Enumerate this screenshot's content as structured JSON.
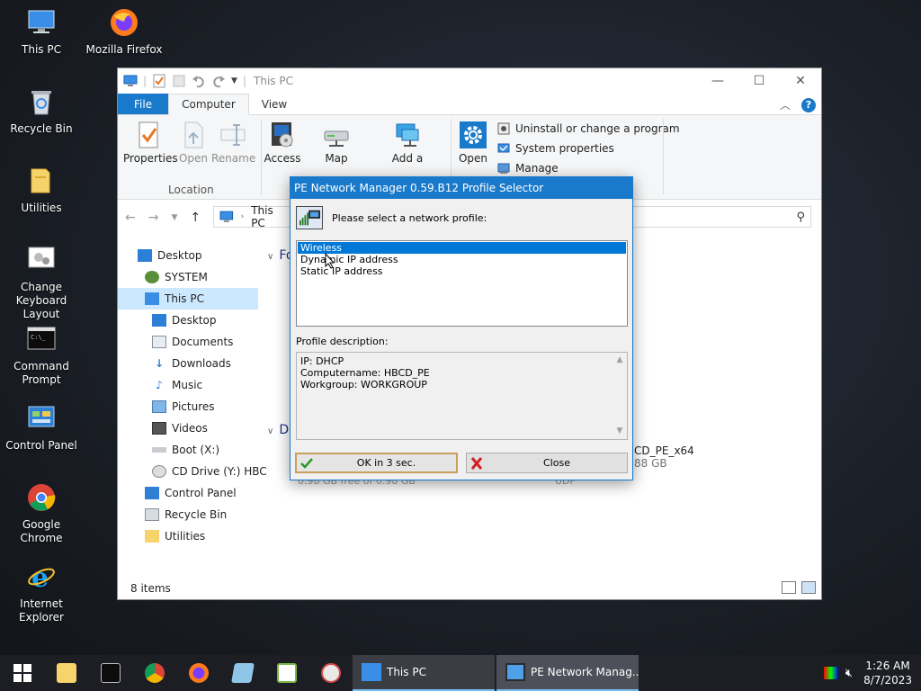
{
  "desktop": {
    "icons": [
      {
        "label": "This PC"
      },
      {
        "label": "Mozilla Firefox"
      },
      {
        "label": "Recycle Bin"
      },
      {
        "label": "Utilities"
      },
      {
        "label": "Change Keyboard Layout"
      },
      {
        "label": "Command Prompt"
      },
      {
        "label": "Control Panel"
      },
      {
        "label": "Google Chrome"
      },
      {
        "label": "Internet Explorer"
      }
    ]
  },
  "explorer": {
    "title": "This PC",
    "tabs": {
      "file": "File",
      "computer": "Computer",
      "view": "View"
    },
    "ribbon": {
      "properties": "Properties",
      "open": "Open",
      "rename": "Rename",
      "location_group": "Location",
      "access_media": "Access media",
      "map_network_drive": "Map network drive",
      "add_network_location": "Add a network location",
      "open_settings": "Open Settings",
      "uninstall": "Uninstall or change a program",
      "system_properties": "System properties",
      "manage": "Manage"
    },
    "address": "This PC",
    "nav_tree": [
      {
        "label": "Desktop"
      },
      {
        "label": "SYSTEM"
      },
      {
        "label": "This PC"
      },
      {
        "label": "Desktop"
      },
      {
        "label": "Documents"
      },
      {
        "label": "Downloads"
      },
      {
        "label": "Music"
      },
      {
        "label": "Pictures"
      },
      {
        "label": "Videos"
      },
      {
        "label": "Boot (X:)"
      },
      {
        "label": "CD Drive (Y:) HBC"
      },
      {
        "label": "Control Panel"
      },
      {
        "label": "Recycle Bin"
      },
      {
        "label": "Utilities"
      }
    ],
    "content": {
      "folders_group_fragment": "Fo",
      "devices_group_fragment": "D",
      "drive_name_fragment": "CD_PE_x64",
      "drive_size_fragment": "88 GB",
      "drive_free_fragment": "0.98 GB free of 0.98 GB",
      "drive_fs_fragment": "UDF"
    },
    "status": "8 items"
  },
  "dialog": {
    "title": "PE Network Manager 0.59.B12 Profile Selector",
    "prompt": "Please select a network profile:",
    "profiles": [
      "Wireless",
      "Dynamic IP address",
      "Static IP address"
    ],
    "selected_profile": "Wireless",
    "description_label": "Profile description:",
    "description_lines": [
      "IP: DHCP",
      "Computername: HBCD_PE",
      "Workgroup: WORKGROUP"
    ],
    "ok_label": "OK in 3 sec.",
    "close_label": "Close"
  },
  "taskbar": {
    "tasks": [
      {
        "label": "This PC"
      },
      {
        "label": "PE Network Manag..."
      }
    ],
    "time": "1:26 AM",
    "date": "8/7/2023"
  },
  "colors": {
    "accent": "#1979ca",
    "selection": "#0078d7",
    "taskbar": "#1c1e24"
  }
}
